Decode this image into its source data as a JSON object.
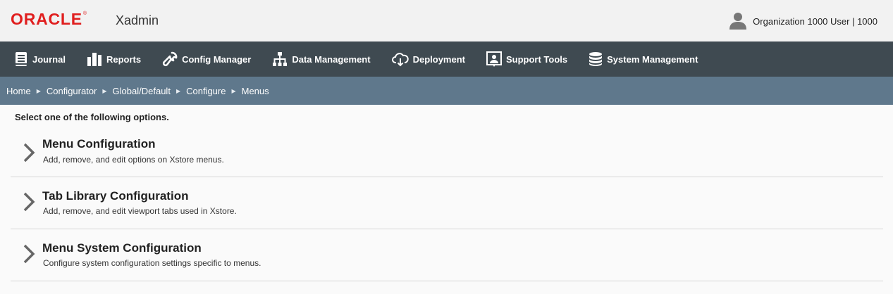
{
  "header": {
    "logo": "ORACLE",
    "logo_mark": "®",
    "app_name": "Xadmin",
    "user_icon": "user-icon",
    "user_label": "Organization 1000 User | 1000"
  },
  "nav": {
    "items": [
      {
        "label": "Journal",
        "icon": "journal-icon"
      },
      {
        "label": "Reports",
        "icon": "reports-icon"
      },
      {
        "label": "Config Manager",
        "icon": "wrench-icon"
      },
      {
        "label": "Data Management",
        "icon": "hierarchy-icon"
      },
      {
        "label": "Deployment",
        "icon": "cloud-download-icon"
      },
      {
        "label": "Support Tools",
        "icon": "support-icon"
      },
      {
        "label": "System Management",
        "icon": "database-icon"
      }
    ]
  },
  "breadcrumb": {
    "items": [
      "Home",
      "Configurator",
      "Global/Default",
      "Configure",
      "Menus"
    ],
    "separator": "▶"
  },
  "main": {
    "intro": "Select one of the following options.",
    "options": [
      {
        "title": "Menu Configuration",
        "description": "Add, remove, and edit options on Xstore menus."
      },
      {
        "title": "Tab Library Configuration",
        "description": "Add, remove, and edit viewport tabs used in Xstore."
      },
      {
        "title": "Menu System Configuration",
        "description": "Configure system configuration settings specific to menus."
      }
    ]
  },
  "colors": {
    "brand_red": "#e01f1f",
    "nav_bg": "#3f4a51",
    "breadcrumb_bg": "#5f788c"
  }
}
